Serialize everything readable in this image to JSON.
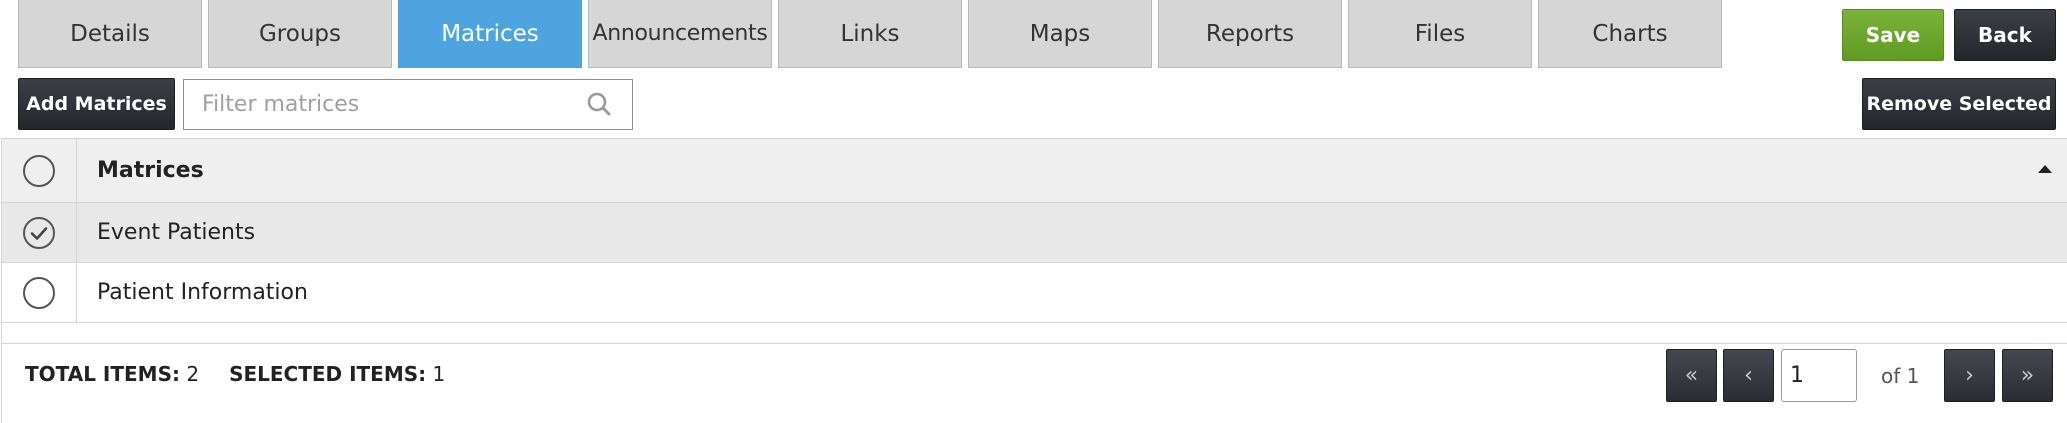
{
  "tabs": [
    {
      "label": "Details"
    },
    {
      "label": "Groups"
    },
    {
      "label": "Matrices"
    },
    {
      "label": "Announcements"
    },
    {
      "label": "Links"
    },
    {
      "label": "Maps"
    },
    {
      "label": "Reports"
    },
    {
      "label": "Files"
    },
    {
      "label": "Charts"
    }
  ],
  "active_tab": "Matrices",
  "actions": {
    "save_label": "Save",
    "back_label": "Back"
  },
  "toolbar": {
    "add_label": "Add Matrices",
    "remove_label": "Remove Selected"
  },
  "search": {
    "placeholder": "Filter matrices",
    "value": ""
  },
  "grid": {
    "header": "Matrices",
    "sort": "ascending",
    "rows": [
      {
        "name": "Event Patients",
        "selected": true
      },
      {
        "name": "Patient Information",
        "selected": false
      }
    ]
  },
  "footer": {
    "total_label": "TOTAL ITEMS:",
    "total_value": "2",
    "selected_label": "SELECTED ITEMS:",
    "selected_value": "1"
  },
  "pager": {
    "current_page": "1",
    "of_text": "of 1",
    "first_glyph": "«",
    "prev_glyph": "‹",
    "next_glyph": "›",
    "last_glyph": "»"
  },
  "colors": {
    "active_tab": "#4ea4de",
    "save": "#6aa62c",
    "dark_button": "#2b2d33"
  }
}
